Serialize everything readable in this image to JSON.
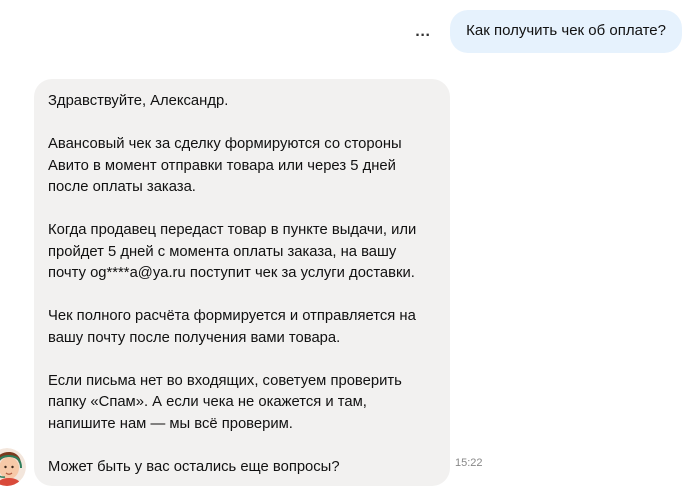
{
  "outgoing": {
    "text": "Как получить чек об оплате?",
    "more_icon": "…"
  },
  "incoming": {
    "paragraphs": [
      "Здравствуйте, Александр.",
      "Авансовый чек за сделку формируются со стороны Авито в момент отправки товара или через 5 дней после оплаты заказа.",
      "Когда продавец  передаст товар в пункте выдачи,  или пройдет 5 дней с момента оплаты заказа, на вашу почту og****a@ya.ru поступит чек за услуги доставки.",
      "Чек полного расчёта формируется и отправляется на вашу почту после получения вами товара.",
      "Если письма нет во входящих, советуем проверить папку «Спам». А если чека не окажется и там, напишите нам — мы всё проверим.",
      "Может быть у вас остались еще вопросы?"
    ],
    "time": "15:22",
    "avatar_icon": "support-agent-avatar"
  }
}
